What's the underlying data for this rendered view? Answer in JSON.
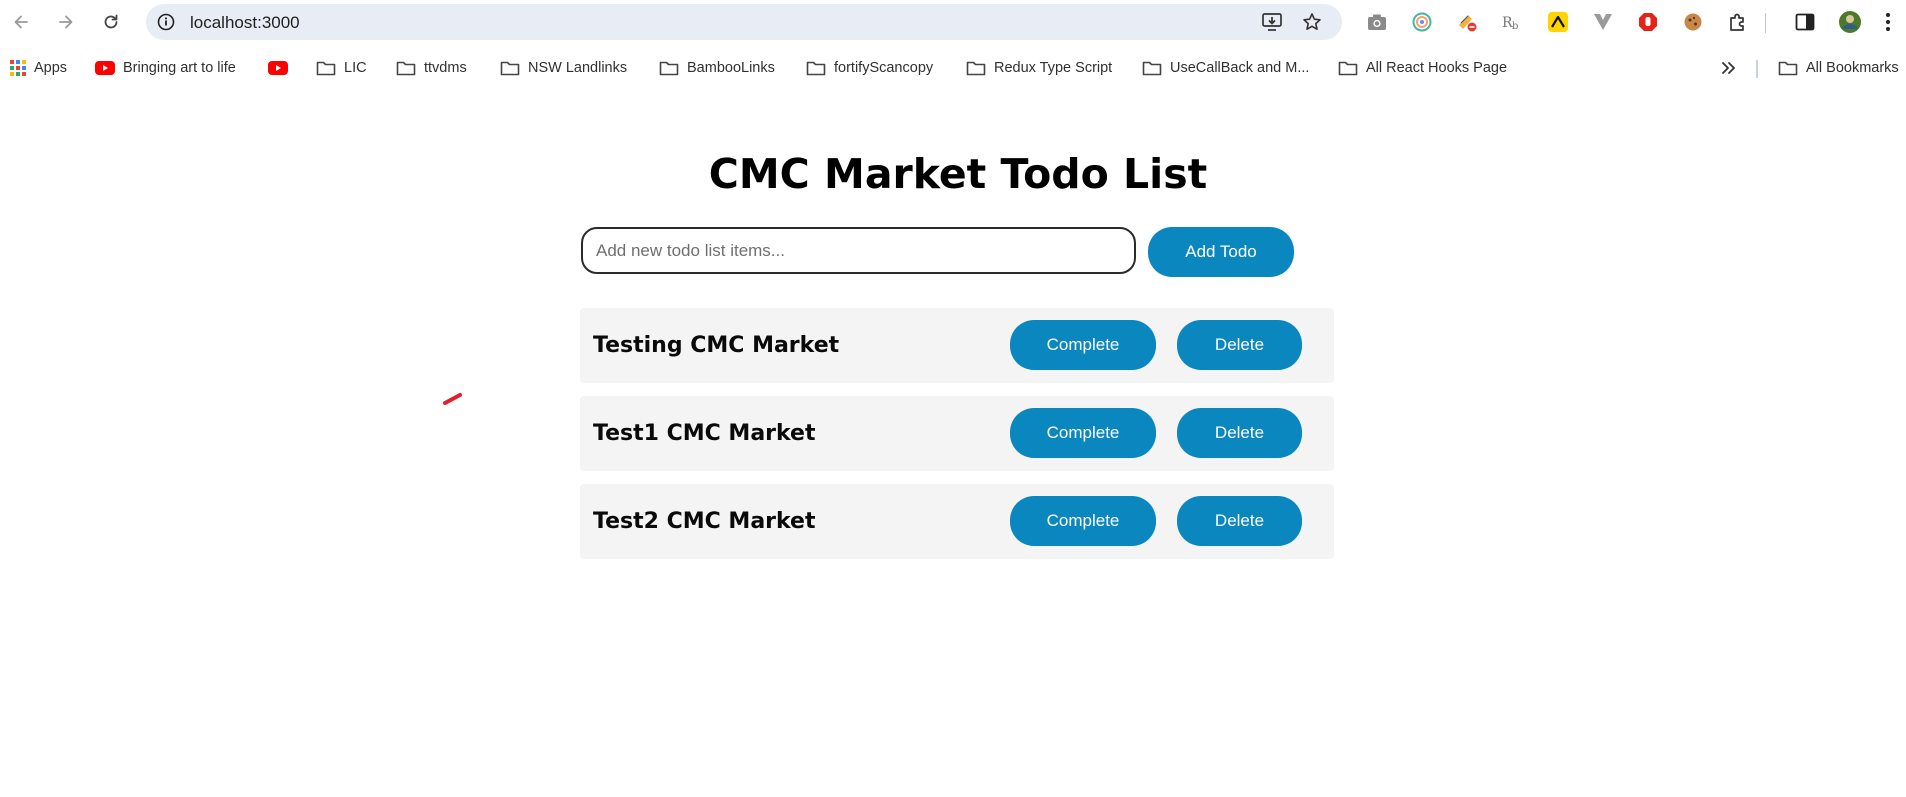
{
  "browser": {
    "url": "localhost:3000",
    "bookmarks": [
      {
        "label": "Apps",
        "icon": "apps-grid-icon"
      },
      {
        "label": "Bringing art to life",
        "icon": "youtube-icon"
      },
      {
        "label": "",
        "icon": "youtube-icon"
      },
      {
        "label": "LIC",
        "icon": "folder-icon"
      },
      {
        "label": "ttvdms",
        "icon": "folder-icon"
      },
      {
        "label": "NSW Landlinks",
        "icon": "folder-icon"
      },
      {
        "label": "BambooLinks",
        "icon": "folder-icon"
      },
      {
        "label": "fortifyScancopy",
        "icon": "folder-icon"
      },
      {
        "label": "Redux Type Script",
        "icon": "folder-icon"
      },
      {
        "label": "UseCallBack and M...",
        "icon": "folder-icon"
      },
      {
        "label": "All React Hooks Page",
        "icon": "folder-icon"
      }
    ],
    "all_bookmarks_label": "All Bookmarks"
  },
  "app": {
    "title": "CMC Market Todo List",
    "input_placeholder": "Add new todo list items...",
    "add_button": "Add Todo",
    "complete_label": "Complete",
    "delete_label": "Delete",
    "todos": [
      {
        "text": "Testing CMC Market"
      },
      {
        "text": "Test1 CMC Market"
      },
      {
        "text": "Test2 CMC Market"
      }
    ]
  },
  "colors": {
    "accent": "#0a87bf",
    "row_background": "#f4f4f4",
    "omnibox_background": "#e8ecf5"
  }
}
